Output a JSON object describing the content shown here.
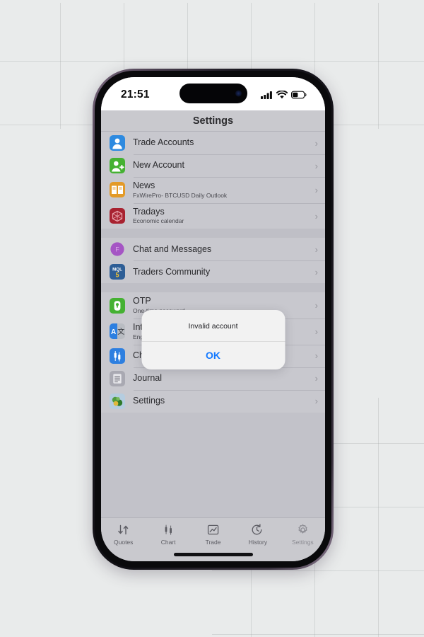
{
  "background": {
    "color": "#e9ebeb",
    "grid_color": "#969b9b"
  },
  "phone": {
    "status_bar": {
      "time": "21:51",
      "icons": [
        "cellular-signal-icon",
        "wifi-icon",
        "battery-icon"
      ],
      "battery_level_pct": 42
    },
    "nav_bar": {
      "title": "Settings"
    }
  },
  "groups": [
    {
      "rows": [
        {
          "icon": "trade-accounts-icon",
          "title": "Trade Accounts",
          "subtitle": ""
        },
        {
          "icon": "new-account-icon",
          "title": "New Account",
          "subtitle": ""
        },
        {
          "icon": "news-icon",
          "title": "News",
          "subtitle": "FxWirePro- BTCUSD Daily Outlook"
        },
        {
          "icon": "tradays-icon",
          "title": "Tradays",
          "subtitle": "Economic calendar"
        }
      ]
    },
    {
      "rows": [
        {
          "icon": "chat-messages-icon",
          "title": "Chat and Messages",
          "subtitle": ""
        },
        {
          "icon": "traders-community-icon",
          "title": "Traders Community",
          "subtitle": ""
        }
      ]
    },
    {
      "rows": [
        {
          "icon": "otp-icon",
          "title": "OTP",
          "subtitle": "One-time password"
        },
        {
          "icon": "interface-icon",
          "title": "Interface",
          "subtitle": "English"
        },
        {
          "icon": "charts-icon",
          "title": "Charts",
          "subtitle": ""
        },
        {
          "icon": "journal-icon",
          "title": "Journal",
          "subtitle": ""
        },
        {
          "icon": "settings-icon",
          "title": "Settings",
          "subtitle": ""
        }
      ]
    }
  ],
  "alert": {
    "message": "Invalid account",
    "ok_label": "OK",
    "ok_color": "#1379ff"
  },
  "tab_bar": {
    "tabs": [
      {
        "icon": "quotes-icon",
        "label": "Quotes",
        "active": false
      },
      {
        "icon": "chart-icon",
        "label": "Chart",
        "active": false
      },
      {
        "icon": "trade-icon",
        "label": "Trade",
        "active": false
      },
      {
        "icon": "history-icon",
        "label": "History",
        "active": false
      },
      {
        "icon": "settings-gear-icon",
        "label": "Settings",
        "active": true
      }
    ]
  }
}
